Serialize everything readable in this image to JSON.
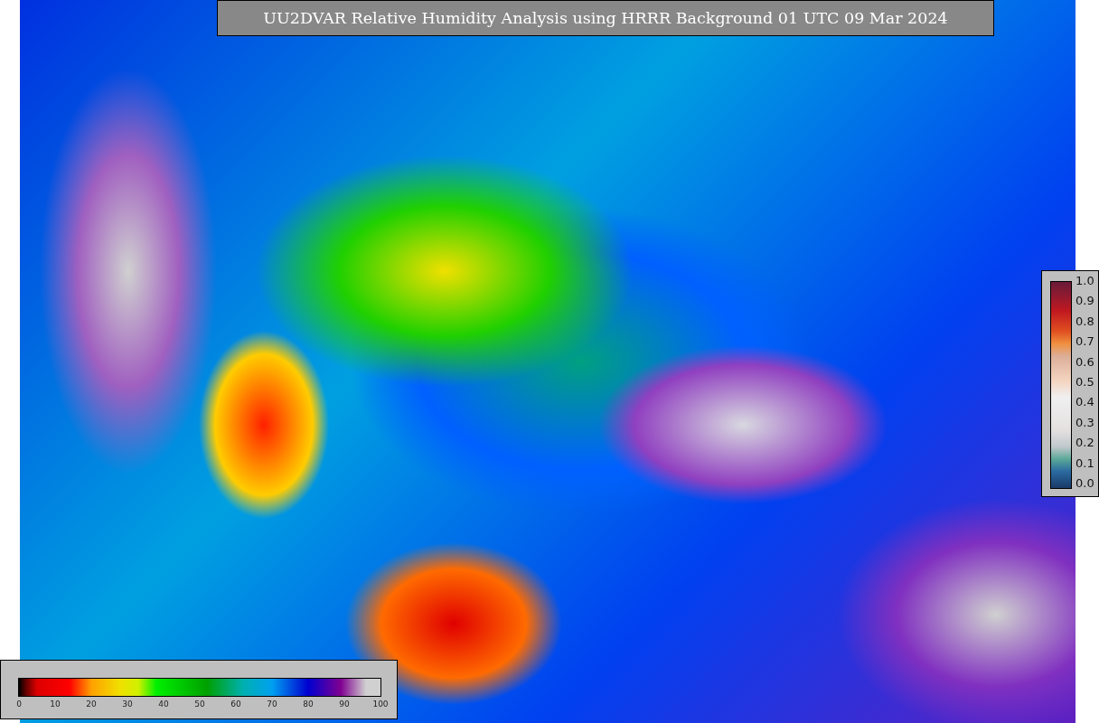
{
  "title": "UU2DVAR Relative Humidity Analysis using HRRR Background 01 UTC 09 Mar 2024",
  "right_colorbar": {
    "labels": [
      "1.0",
      "0.9",
      "0.8",
      "0.7",
      "0.6",
      "0.5",
      "0.4",
      "0.3",
      "0.2",
      "0.1",
      "0.0"
    ]
  },
  "bottom_colorbar": {
    "labels": [
      "0",
      "10",
      "20",
      "30",
      "40",
      "50",
      "60",
      "70",
      "80",
      "90",
      "100"
    ]
  }
}
